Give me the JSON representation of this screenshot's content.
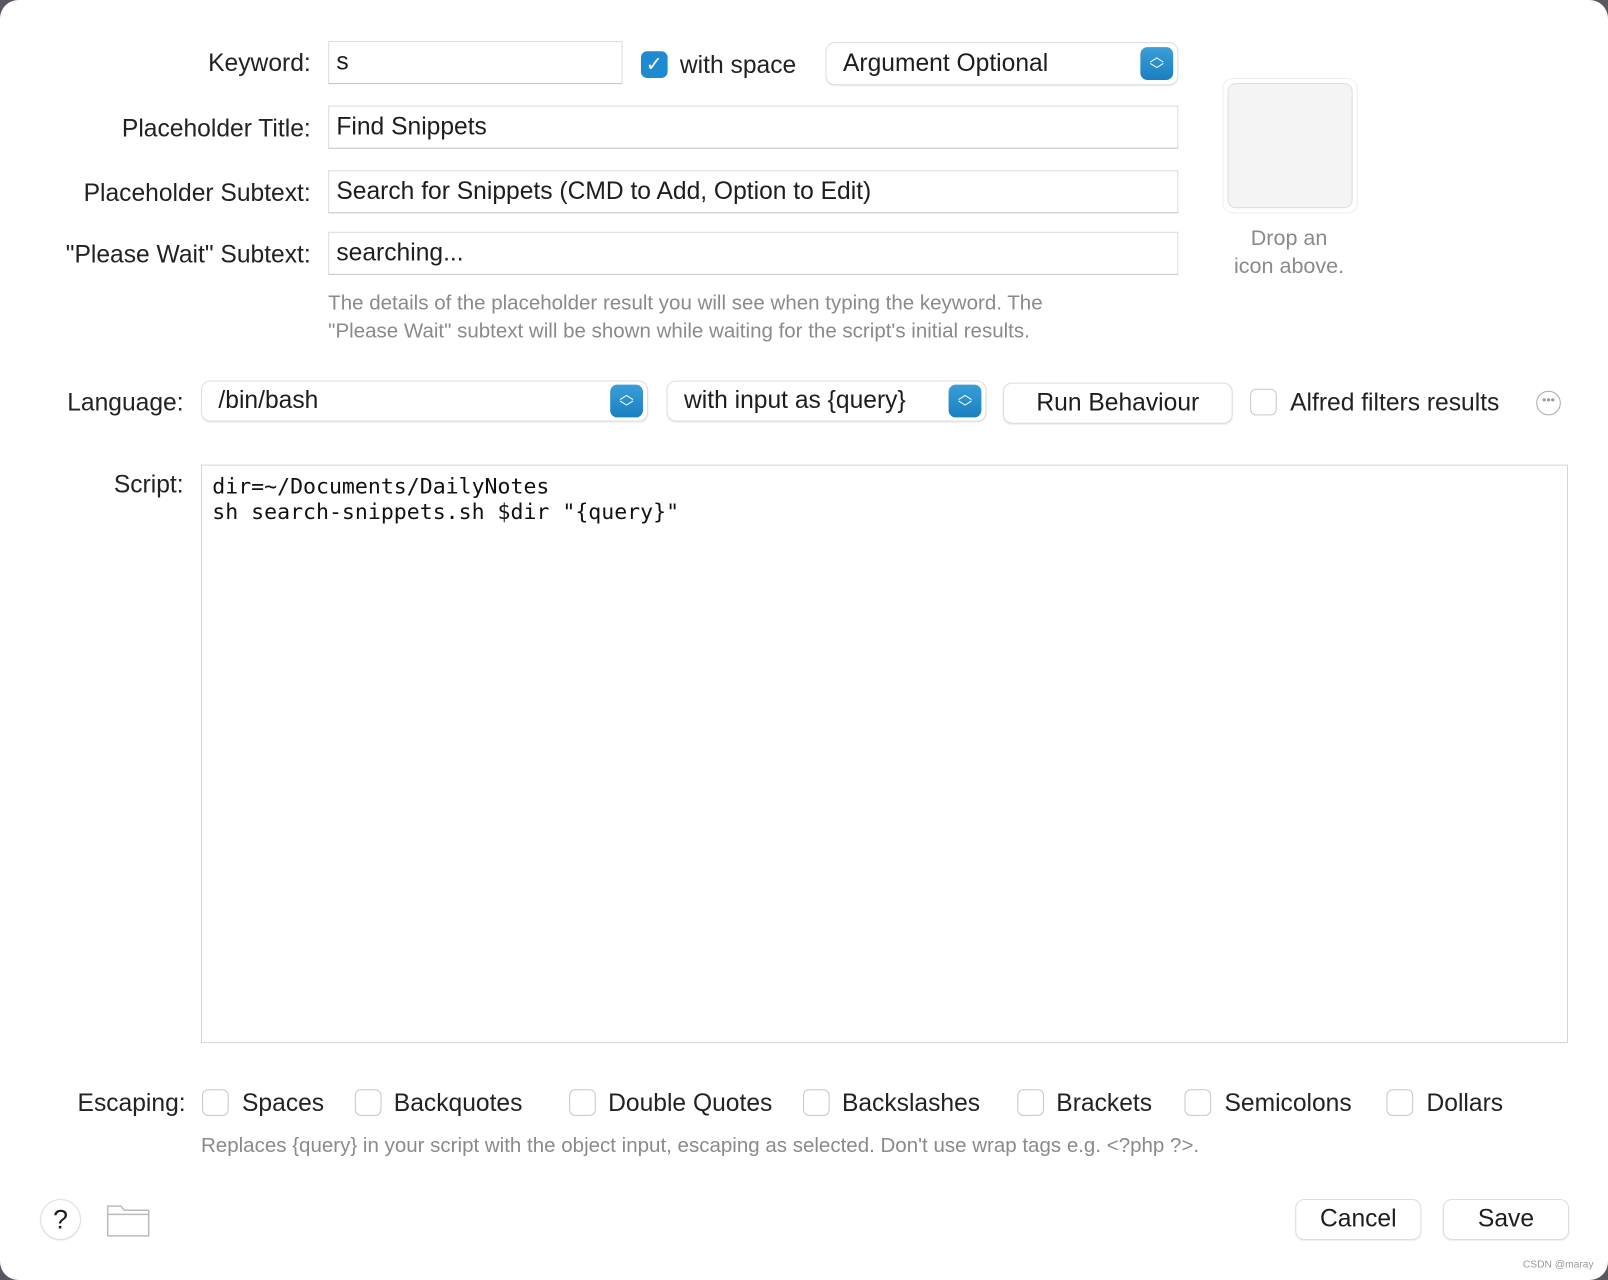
{
  "keyword": {
    "label": "Keyword:",
    "value": "s",
    "with_space_label": "with space",
    "with_space_checked": true,
    "argument_option": "Argument Optional"
  },
  "placeholder_title": {
    "label": "Placeholder Title:",
    "value": "Find Snippets"
  },
  "placeholder_subtext": {
    "label": "Placeholder Subtext:",
    "value": "Search for Snippets (CMD to Add, Option to Edit)"
  },
  "please_wait": {
    "label": "\"Please Wait\" Subtext:",
    "value": "searching..."
  },
  "hint1": "The details of the placeholder result you will see when typing the keyword. The",
  "hint2": "\"Please Wait\" subtext will be shown while waiting for the script's initial results.",
  "icon_drop": {
    "line1": "Drop an",
    "line2": "icon above."
  },
  "language": {
    "label": "Language:",
    "value": "/bin/bash",
    "input_mode": "with input as {query}",
    "run_behaviour": "Run Behaviour",
    "alfred_filters_label": "Alfred filters results",
    "alfred_filters_checked": false
  },
  "script": {
    "label": "Script:",
    "line1": "dir=~/Documents/DailyNotes",
    "line2": "sh search-snippets.sh $dir \"{query}\""
  },
  "escaping": {
    "label": "Escaping:",
    "options": [
      {
        "label": "Spaces",
        "checked": false
      },
      {
        "label": "Backquotes",
        "checked": false
      },
      {
        "label": "Double Quotes",
        "checked": false
      },
      {
        "label": "Backslashes",
        "checked": false
      },
      {
        "label": "Brackets",
        "checked": false
      },
      {
        "label": "Semicolons",
        "checked": false
      },
      {
        "label": "Dollars",
        "checked": false
      }
    ],
    "hint": "Replaces {query} in your script with the object input, escaping as selected. Don't use wrap tags e.g. <?php ?>."
  },
  "footer": {
    "help": "?",
    "cancel": "Cancel",
    "save": "Save",
    "watermark": "CSDN @maray"
  },
  "colors": {
    "accent": "#1e8ad0"
  }
}
